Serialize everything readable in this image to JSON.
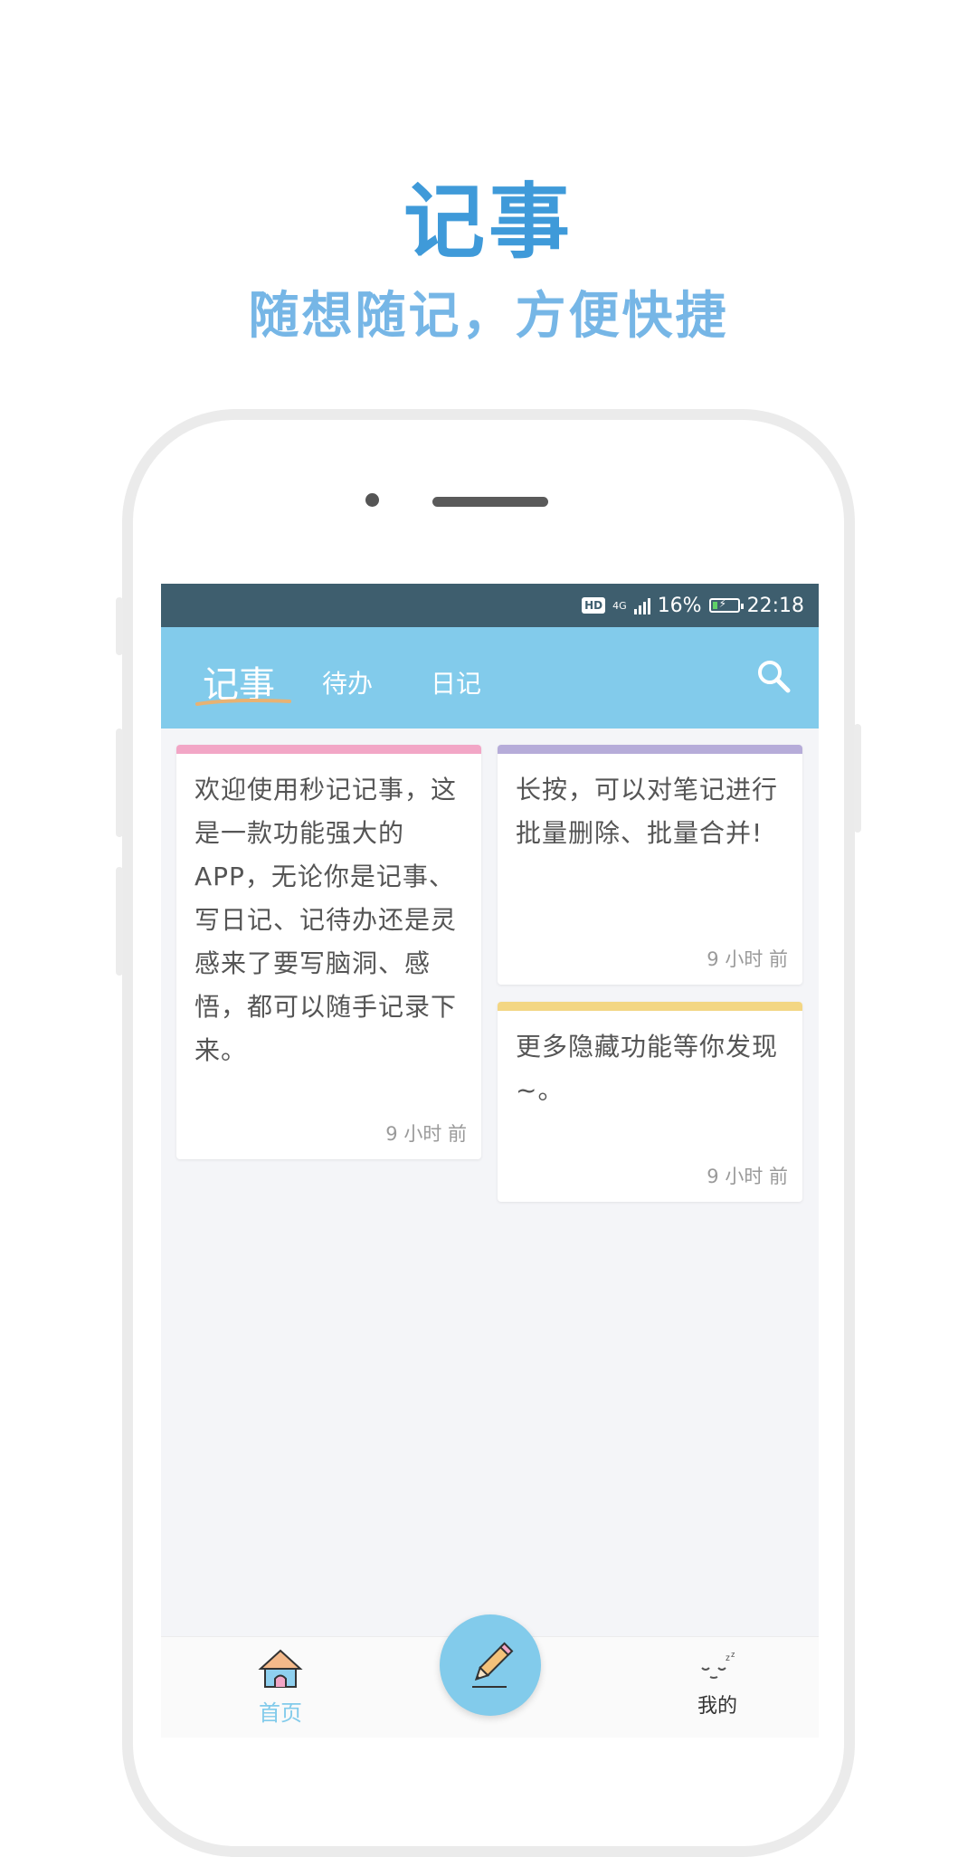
{
  "promo": {
    "title": "记事",
    "subtitle": "随想随记，方便快捷"
  },
  "status_bar": {
    "hd": "HD",
    "network": "4G",
    "battery_percent": "16%",
    "time": "22:18",
    "icons": [
      "hd-icon",
      "signal-icon",
      "battery-charging-icon"
    ]
  },
  "app_bar": {
    "tabs": [
      {
        "label": "记事",
        "active": true
      },
      {
        "label": "待办",
        "active": false
      },
      {
        "label": "日记",
        "active": false
      }
    ],
    "search_icon": "search-icon",
    "accent_color": "#82cbeb",
    "status_color": "#3e5e6e"
  },
  "notes": [
    {
      "text": "欢迎使用秒记记事，这是一款功能强大的APP，无论你是记事、写日记、记待办还是灵感来了要写脑洞、感悟，都可以随手记录下来。",
      "time": "9 小时 前",
      "color": "#f2a6c6"
    },
    {
      "text": "长按，可以对笔记进行批量删除、批量合并!",
      "time": "9 小时 前",
      "color": "#b6acd9"
    },
    {
      "text": "更多隐藏功能等你发现~。",
      "time": "9 小时 前",
      "color": "#f3d684"
    }
  ],
  "bottom_nav": {
    "home_label": "首页",
    "mine_label": "我的",
    "home_icon": "house-icon",
    "mine_icon": "sleeping-face-icon",
    "fab_icon": "pencil-icon"
  }
}
